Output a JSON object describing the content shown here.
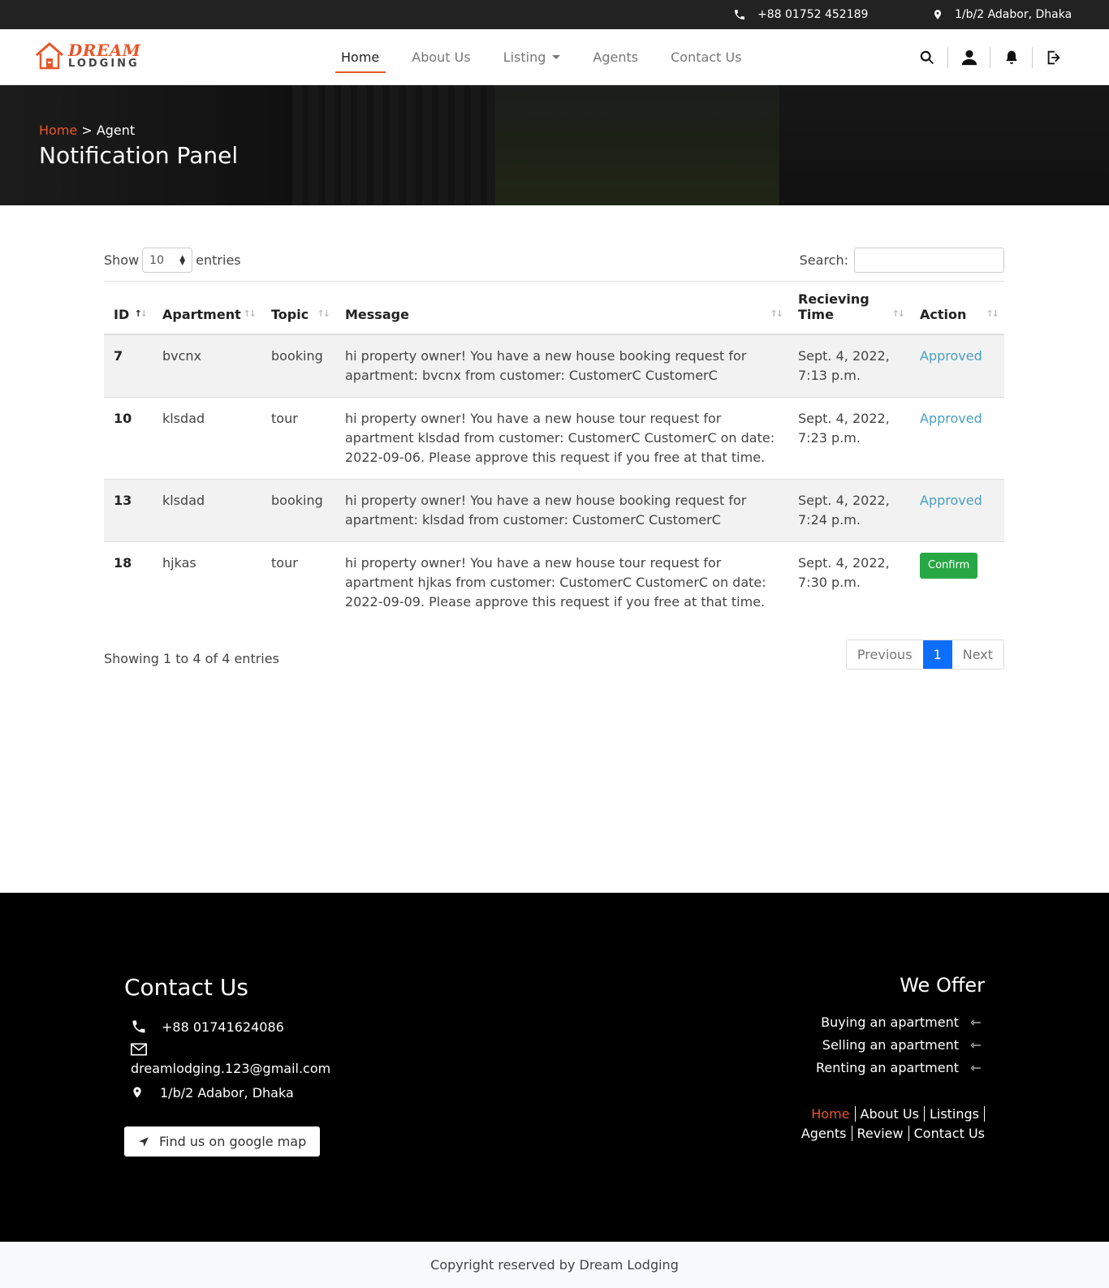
{
  "topbar": {
    "phone": "+88 01752 452189",
    "address": "1/b/2 Adabor, Dhaka"
  },
  "brand": {
    "word1": "DREAM",
    "word2": "LODGING"
  },
  "nav": {
    "home": "Home",
    "about": "About Us",
    "listing": "Listing",
    "agents": "Agents",
    "contact": "Contact Us"
  },
  "hero": {
    "crumb_home": "Home",
    "crumb_sep": " > ",
    "crumb_current": "Agent",
    "title": "Notification Panel"
  },
  "table_controls": {
    "show_label": "Show",
    "page_size": "10",
    "entries_label": "entries",
    "search_label": "Search:",
    "search_value": ""
  },
  "columns": [
    "ID",
    "Apartment",
    "Topic",
    "Message",
    "Recieving Time",
    "Action"
  ],
  "rows": [
    {
      "id": "7",
      "apartment": "bvcnx",
      "topic": "booking",
      "message": "hi property owner! You have a new house booking request for apartment: bvcnx from customer: CustomerC CustomerC",
      "time": "Sept. 4, 2022, 7:13 p.m.",
      "action": "Approved"
    },
    {
      "id": "10",
      "apartment": "klsdad",
      "topic": "tour",
      "message": "hi property owner! You have a new house tour request for apartment klsdad from customer: CustomerC CustomerC on date: 2022-09-06. Please approve this request if you free at that time.",
      "time": "Sept. 4, 2022, 7:23 p.m.",
      "action": "Approved"
    },
    {
      "id": "13",
      "apartment": "klsdad",
      "topic": "booking",
      "message": "hi property owner! You have a new house booking request for apartment: klsdad from customer: CustomerC CustomerC",
      "time": "Sept. 4, 2022, 7:24 p.m.",
      "action": "Approved"
    },
    {
      "id": "18",
      "apartment": "hjkas",
      "topic": "tour",
      "message": "hi property owner! You have a new house tour request for apartment hjkas from customer: CustomerC CustomerC on date: 2022-09-09. Please approve this request if you free at that time.",
      "time": "Sept. 4, 2022, 7:30 p.m.",
      "action": "Confirm"
    }
  ],
  "table_footer": {
    "info": "Showing 1 to 4 of 4 entries",
    "prev": "Previous",
    "page": "1",
    "next": "Next"
  },
  "footer": {
    "contact_title": "Contact Us",
    "phone": "+88 01741624086",
    "email": "dreamlodging.123@gmail.com",
    "address": "1/b/2 Adabor, Dhaka",
    "map_button": "Find us on google map",
    "offer_title": "We Offer",
    "offers": [
      "Buying an apartment",
      "Selling an apartment",
      "Renting an apartment"
    ],
    "links": {
      "home": "Home",
      "about": "About Us",
      "listings": "Listings",
      "agents": "Agents",
      "review": "Review",
      "contact": "Contact Us"
    },
    "copyright": "Copyright reserved by Dream Lodging"
  },
  "colors": {
    "accent": "#e8562a",
    "approved": "#4a9fc2",
    "confirm": "#28a745",
    "pager_active": "#0d6efd"
  }
}
